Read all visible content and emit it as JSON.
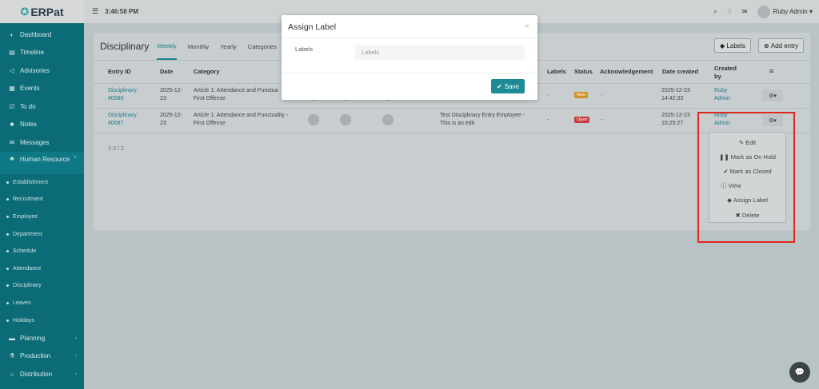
{
  "app": {
    "logo": "ERPat"
  },
  "topbar": {
    "time": "3:46:58 PM",
    "user": "Ruby Admin"
  },
  "sidebar": {
    "items": [
      {
        "label": "Dashboard",
        "icon": "dashboard-icon"
      },
      {
        "label": "Timeline",
        "icon": "timeline-icon"
      },
      {
        "label": "Advisories",
        "icon": "bullhorn-icon"
      },
      {
        "label": "Events",
        "icon": "calendar-icon"
      },
      {
        "label": "To do",
        "icon": "checkbox-icon"
      },
      {
        "label": "Notes",
        "icon": "note-icon"
      },
      {
        "label": "Messages",
        "icon": "envelope-icon"
      }
    ],
    "active": {
      "label": "Human Resource",
      "icon": "people-icon"
    },
    "sub_items": [
      "Establishment",
      "Recruitment",
      "Employee",
      "Department",
      "Schedule",
      "Attendance",
      "Disciplinary",
      "Leaves",
      "Holidays"
    ],
    "bottom_items": [
      {
        "label": "Planning",
        "icon": "briefcase-icon"
      },
      {
        "label": "Production",
        "icon": "flask-icon"
      },
      {
        "label": "Distribution",
        "icon": "bank-icon"
      }
    ]
  },
  "page": {
    "title": "Disciplinary",
    "tabs": [
      "Weekly",
      "Monthly",
      "Yearly",
      "Categories"
    ],
    "labels_button": "Labels",
    "add_button": "Add entry",
    "pager": "1-2 / 2"
  },
  "table": {
    "headers": {
      "entry_id": "Entry ID",
      "date": "Date",
      "category": "Category",
      "labels": "Labels",
      "status": "Status",
      "ack": "Acknowledgement",
      "date_created": "Date created",
      "created_by": "Created by",
      "menu": "≡"
    },
    "rows": [
      {
        "id_line1": "Disciplinary",
        "id_line2": "#0086",
        "date_line1": "2025-12-",
        "date_line2": "23",
        "cat_line1": "Article 1: Attendance and Punctua",
        "cat_line2": "First Offense",
        "desc_line1": "",
        "desc_line2": "",
        "labels": "-",
        "status": "New",
        "ack": "-",
        "created_line1": "2025-12-23",
        "created_line2": "14:42:33",
        "by_line1": "Ruby",
        "by_line2": "Admin"
      },
      {
        "id_line1": "Disciplinary",
        "id_line2": "#0087",
        "date_line1": "2025-12-",
        "date_line2": "23",
        "cat_line1": "Article 1: Attendance and Punctuality -",
        "cat_line2": "First Offense",
        "desc_line1": "Test Disciplinary Entry Employee -",
        "desc_line2": "This is an edit",
        "labels": "-",
        "status": "Open",
        "ack": "-",
        "created_line1": "2025-12-23",
        "created_line2": "15:25:27",
        "by_line1": "Ruby",
        "by_line2": "Admin"
      }
    ]
  },
  "dropdown": {
    "items": [
      "Edit",
      "Mark as On Hold",
      "Mark as Closed",
      "View",
      "Assign Label",
      "Delete"
    ]
  },
  "modal": {
    "title": "Assign Label",
    "close": "×",
    "field_label": "Labels",
    "placeholder": "Labels",
    "save": "Save"
  },
  "colors": {
    "accent": "#1d8b97",
    "sidebar": "#0b6b77",
    "highlight": "#e0281e",
    "status_new": "#d1922a",
    "status_open": "#c93a3a"
  }
}
